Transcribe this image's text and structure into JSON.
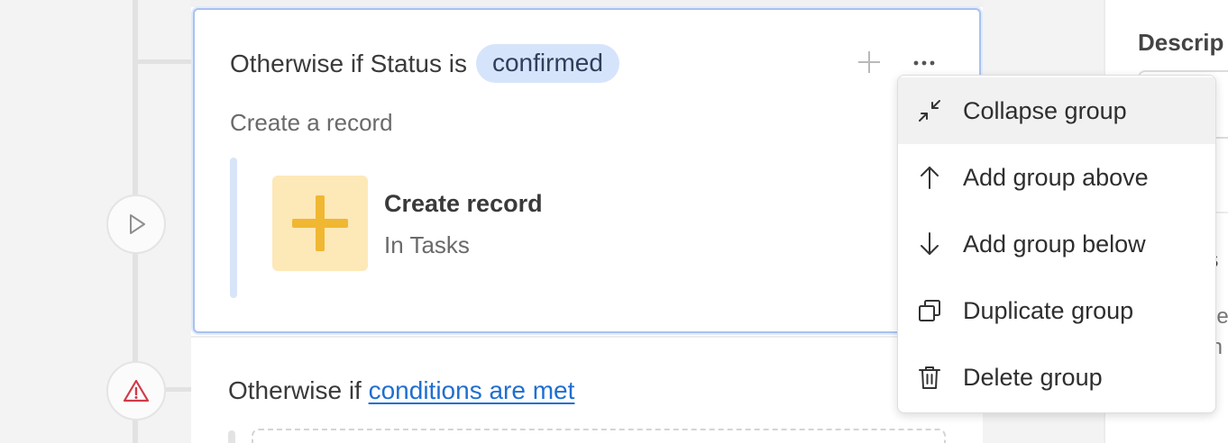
{
  "group": {
    "title_prefix": "Otherwise if Status is",
    "status_value": "confirmed",
    "subtitle": "Create a record",
    "action": {
      "title": "Create record",
      "subtitle": "In Tasks",
      "icon": "plus-icon",
      "icon_color": "#f0b732",
      "icon_bg": "#fde8b8"
    },
    "add_icon": "plus-icon",
    "more_icon": "ellipsis-icon"
  },
  "group2": {
    "title_prefix": "Otherwise if",
    "condition_link": "conditions are met"
  },
  "menu": {
    "items": [
      {
        "label": "Collapse group",
        "icon": "collapse-icon",
        "highlighted": true
      },
      {
        "label": "Add group above",
        "icon": "arrow-up-icon"
      },
      {
        "label": "Add group below",
        "icon": "arrow-down-icon"
      },
      {
        "label": "Duplicate group",
        "icon": "duplicate-icon"
      },
      {
        "label": "Delete group",
        "icon": "trash-icon"
      }
    ]
  },
  "right_panel": {
    "label_fragment": "Descrip",
    "input_fragment": "r",
    "heading_fragment": "s",
    "text_fragment_1": "ne",
    "text_fragment_2": "th"
  },
  "timeline": {
    "node_icons": [
      "play-icon",
      "warning-icon"
    ],
    "warning_color": "#d23a4a"
  },
  "colors": {
    "accent": "#a9c2ee",
    "pill_bg": "#d6e4fb",
    "link": "#1f6fd1"
  }
}
